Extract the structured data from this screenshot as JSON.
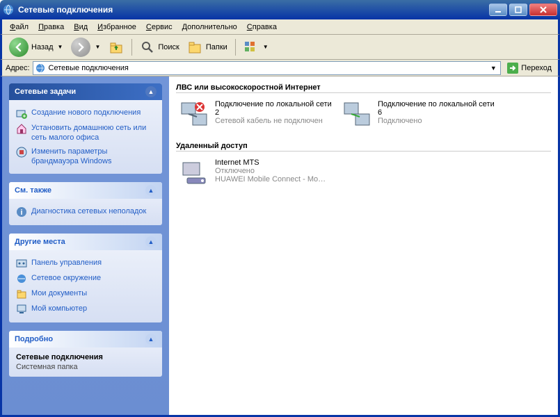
{
  "window": {
    "title": "Сетевые подключения"
  },
  "menu": {
    "file": "Файл",
    "edit": "Правка",
    "view": "Вид",
    "favorites": "Избранное",
    "service": "Сервис",
    "extra": "Дополнительно",
    "help": "Справка"
  },
  "toolbar": {
    "back": "Назад",
    "search": "Поиск",
    "folders": "Папки"
  },
  "address": {
    "label": "Адрес:",
    "value": "Сетевые подключения",
    "go": "Переход"
  },
  "panels": {
    "tasks": {
      "title": "Сетевые задачи",
      "items": [
        "Создание нового подключения",
        "Установить домашнюю сеть или сеть малого офиса",
        "Изменить параметры брандмауэра Windows"
      ]
    },
    "seealso": {
      "title": "См. также",
      "items": [
        "Диагностика сетевых неполадок"
      ]
    },
    "places": {
      "title": "Другие места",
      "items": [
        "Панель управления",
        "Сетевое окружение",
        "Мои документы",
        "Мой компьютер"
      ]
    },
    "details": {
      "title": "Подробно",
      "name": "Сетевые подключения",
      "type": "Системная папка"
    }
  },
  "sections": {
    "lan": {
      "title": "ЛВС или высокоскоростной Интернет",
      "items": [
        {
          "name": "Подключение по локальной сети 2",
          "status": "Сетевой кабель не подключен",
          "state": "disconnected"
        },
        {
          "name": "Подключение по локальной сети 6",
          "status": "Подключено",
          "state": "connected"
        }
      ]
    },
    "dialup": {
      "title": "Удаленный доступ",
      "items": [
        {
          "name": "Internet MTS",
          "status": "Отключено",
          "device": "HUAWEI Mobile Connect - Mo…"
        }
      ]
    }
  }
}
